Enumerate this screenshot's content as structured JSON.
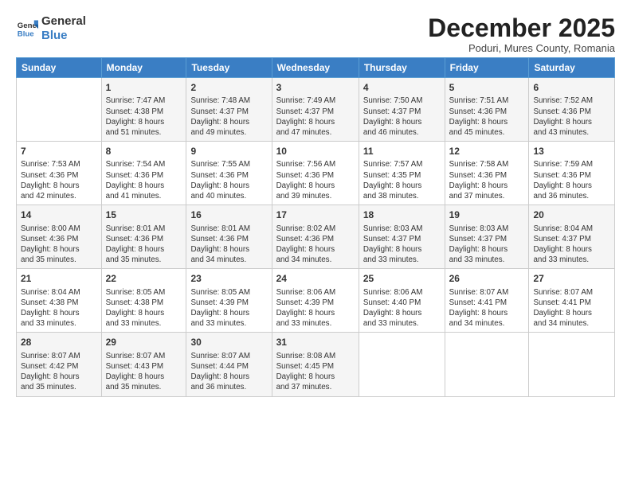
{
  "header": {
    "logo_general": "General",
    "logo_blue": "Blue",
    "month_title": "December 2025",
    "subtitle": "Poduri, Mures County, Romania"
  },
  "days_of_week": [
    "Sunday",
    "Monday",
    "Tuesday",
    "Wednesday",
    "Thursday",
    "Friday",
    "Saturday"
  ],
  "weeks": [
    [
      {
        "day": "",
        "info": ""
      },
      {
        "day": "1",
        "info": "Sunrise: 7:47 AM\nSunset: 4:38 PM\nDaylight: 8 hours\nand 51 minutes."
      },
      {
        "day": "2",
        "info": "Sunrise: 7:48 AM\nSunset: 4:37 PM\nDaylight: 8 hours\nand 49 minutes."
      },
      {
        "day": "3",
        "info": "Sunrise: 7:49 AM\nSunset: 4:37 PM\nDaylight: 8 hours\nand 47 minutes."
      },
      {
        "day": "4",
        "info": "Sunrise: 7:50 AM\nSunset: 4:37 PM\nDaylight: 8 hours\nand 46 minutes."
      },
      {
        "day": "5",
        "info": "Sunrise: 7:51 AM\nSunset: 4:36 PM\nDaylight: 8 hours\nand 45 minutes."
      },
      {
        "day": "6",
        "info": "Sunrise: 7:52 AM\nSunset: 4:36 PM\nDaylight: 8 hours\nand 43 minutes."
      }
    ],
    [
      {
        "day": "7",
        "info": "Sunrise: 7:53 AM\nSunset: 4:36 PM\nDaylight: 8 hours\nand 42 minutes."
      },
      {
        "day": "8",
        "info": "Sunrise: 7:54 AM\nSunset: 4:36 PM\nDaylight: 8 hours\nand 41 minutes."
      },
      {
        "day": "9",
        "info": "Sunrise: 7:55 AM\nSunset: 4:36 PM\nDaylight: 8 hours\nand 40 minutes."
      },
      {
        "day": "10",
        "info": "Sunrise: 7:56 AM\nSunset: 4:36 PM\nDaylight: 8 hours\nand 39 minutes."
      },
      {
        "day": "11",
        "info": "Sunrise: 7:57 AM\nSunset: 4:35 PM\nDaylight: 8 hours\nand 38 minutes."
      },
      {
        "day": "12",
        "info": "Sunrise: 7:58 AM\nSunset: 4:36 PM\nDaylight: 8 hours\nand 37 minutes."
      },
      {
        "day": "13",
        "info": "Sunrise: 7:59 AM\nSunset: 4:36 PM\nDaylight: 8 hours\nand 36 minutes."
      }
    ],
    [
      {
        "day": "14",
        "info": "Sunrise: 8:00 AM\nSunset: 4:36 PM\nDaylight: 8 hours\nand 35 minutes."
      },
      {
        "day": "15",
        "info": "Sunrise: 8:01 AM\nSunset: 4:36 PM\nDaylight: 8 hours\nand 35 minutes."
      },
      {
        "day": "16",
        "info": "Sunrise: 8:01 AM\nSunset: 4:36 PM\nDaylight: 8 hours\nand 34 minutes."
      },
      {
        "day": "17",
        "info": "Sunrise: 8:02 AM\nSunset: 4:36 PM\nDaylight: 8 hours\nand 34 minutes."
      },
      {
        "day": "18",
        "info": "Sunrise: 8:03 AM\nSunset: 4:37 PM\nDaylight: 8 hours\nand 33 minutes."
      },
      {
        "day": "19",
        "info": "Sunrise: 8:03 AM\nSunset: 4:37 PM\nDaylight: 8 hours\nand 33 minutes."
      },
      {
        "day": "20",
        "info": "Sunrise: 8:04 AM\nSunset: 4:37 PM\nDaylight: 8 hours\nand 33 minutes."
      }
    ],
    [
      {
        "day": "21",
        "info": "Sunrise: 8:04 AM\nSunset: 4:38 PM\nDaylight: 8 hours\nand 33 minutes."
      },
      {
        "day": "22",
        "info": "Sunrise: 8:05 AM\nSunset: 4:38 PM\nDaylight: 8 hours\nand 33 minutes."
      },
      {
        "day": "23",
        "info": "Sunrise: 8:05 AM\nSunset: 4:39 PM\nDaylight: 8 hours\nand 33 minutes."
      },
      {
        "day": "24",
        "info": "Sunrise: 8:06 AM\nSunset: 4:39 PM\nDaylight: 8 hours\nand 33 minutes."
      },
      {
        "day": "25",
        "info": "Sunrise: 8:06 AM\nSunset: 4:40 PM\nDaylight: 8 hours\nand 33 minutes."
      },
      {
        "day": "26",
        "info": "Sunrise: 8:07 AM\nSunset: 4:41 PM\nDaylight: 8 hours\nand 34 minutes."
      },
      {
        "day": "27",
        "info": "Sunrise: 8:07 AM\nSunset: 4:41 PM\nDaylight: 8 hours\nand 34 minutes."
      }
    ],
    [
      {
        "day": "28",
        "info": "Sunrise: 8:07 AM\nSunset: 4:42 PM\nDaylight: 8 hours\nand 35 minutes."
      },
      {
        "day": "29",
        "info": "Sunrise: 8:07 AM\nSunset: 4:43 PM\nDaylight: 8 hours\nand 35 minutes."
      },
      {
        "day": "30",
        "info": "Sunrise: 8:07 AM\nSunset: 4:44 PM\nDaylight: 8 hours\nand 36 minutes."
      },
      {
        "day": "31",
        "info": "Sunrise: 8:08 AM\nSunset: 4:45 PM\nDaylight: 8 hours\nand 37 minutes."
      },
      {
        "day": "",
        "info": ""
      },
      {
        "day": "",
        "info": ""
      },
      {
        "day": "",
        "info": ""
      }
    ]
  ]
}
